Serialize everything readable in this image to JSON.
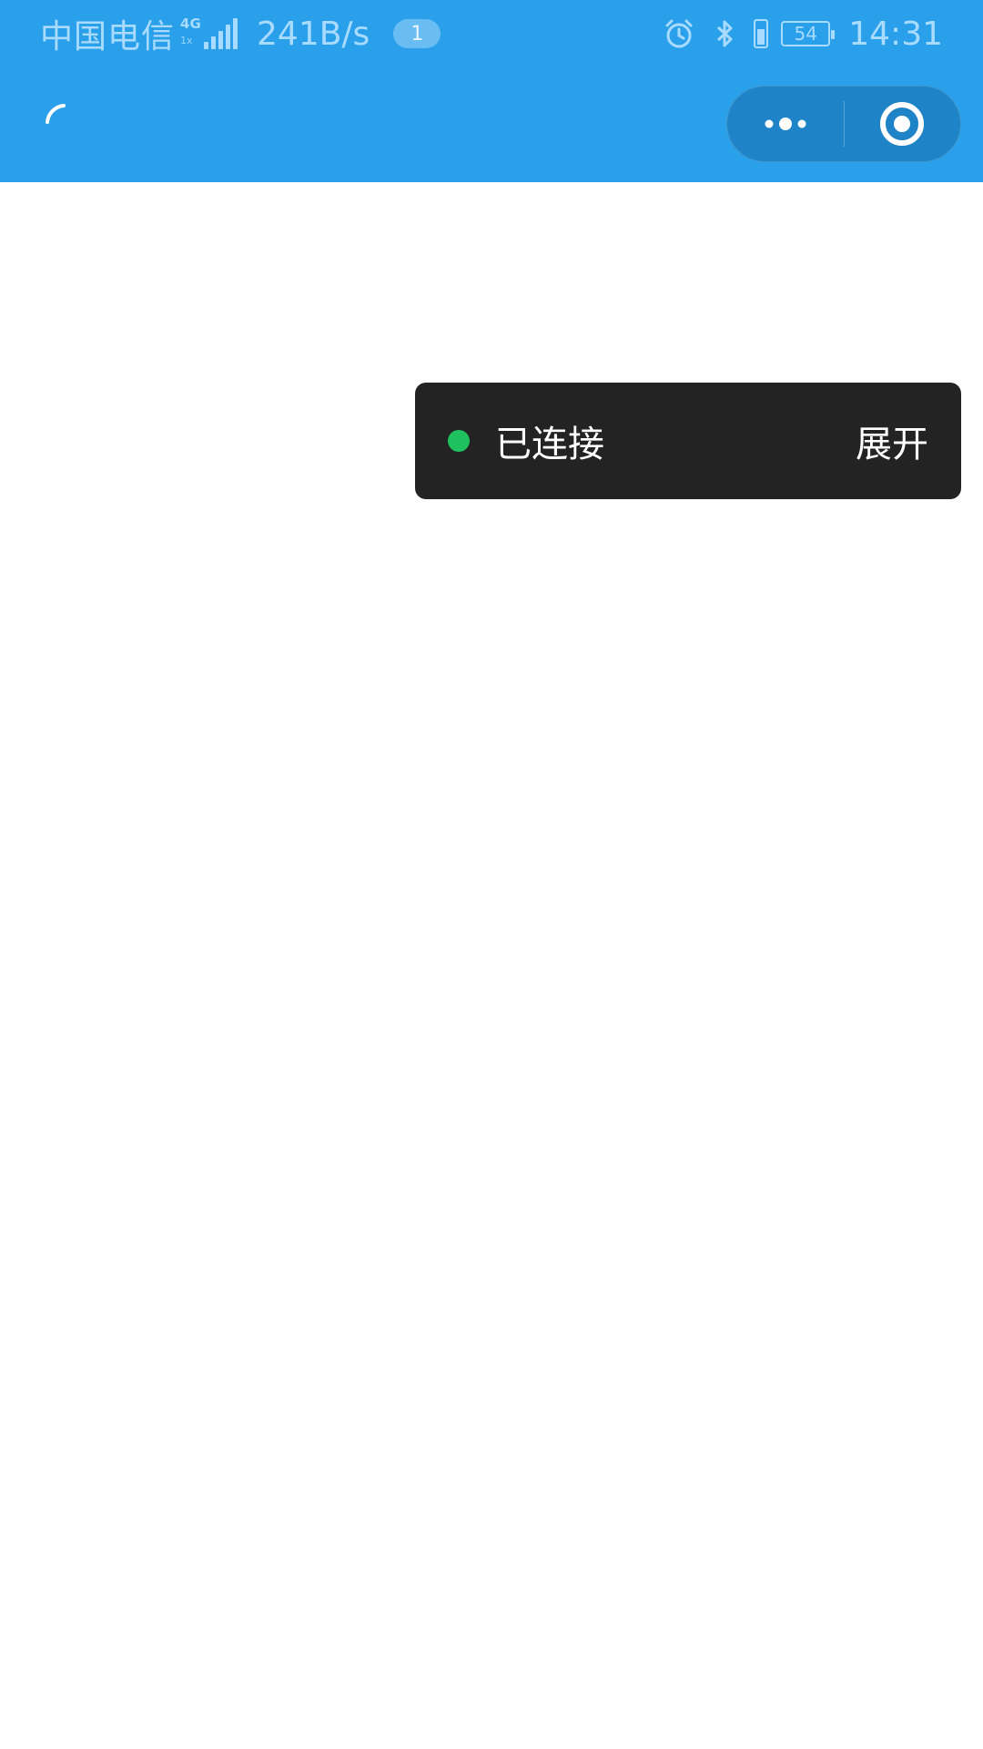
{
  "status_bar": {
    "carrier": "中国电信",
    "network_type": "4G",
    "network_sub": "1x",
    "net_speed": "241B/s",
    "notification_count": "1",
    "battery_level": "54",
    "time": "14:31",
    "icons": [
      "signal-icon",
      "alarm-icon",
      "bluetooth-icon",
      "vibrate-icon",
      "battery-icon"
    ]
  },
  "nav": {
    "icons": [
      "loading-spinner-icon",
      "more-dots-icon",
      "close-target-icon"
    ]
  },
  "toast": {
    "status_label": "已连接",
    "expand_label": "展开",
    "status_color": "#1fc060"
  },
  "colors": {
    "header_bg": "#2aa0ea",
    "capsule_bg": "#1f84c7",
    "toast_bg": "#232324"
  }
}
